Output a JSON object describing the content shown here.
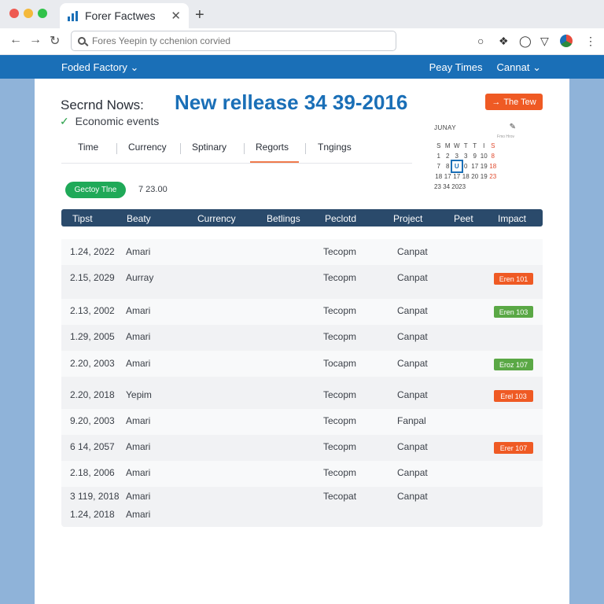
{
  "browser": {
    "tab_title": "Forer Factwes",
    "close_glyph": "✕",
    "new_tab_glyph": "+",
    "url_placeholder": "Fores Yeepin ty cchenion corvied"
  },
  "site": {
    "brand": "Foded Factory",
    "right_links": [
      "Peay Times",
      "Cannat"
    ]
  },
  "page": {
    "subtitle": "Secrnd Nows:",
    "events_label": "Economic events",
    "headline": "New rellease 34 39-2016",
    "cta_label": "The Tew",
    "filters": [
      "Time",
      "Currency",
      "Sptinary",
      "Regorts",
      "Tngings"
    ],
    "active_filter": 3,
    "pill_label": "Gectoy Tlne",
    "pill_value": "7 23.00"
  },
  "calendar": {
    "month": "JUNAY",
    "sub_label": "Fmo Hrov",
    "weekdays": [
      "S",
      "M",
      "W",
      "T",
      "T",
      "I",
      "S"
    ],
    "rows": [
      [
        "",
        "",
        "",
        "",
        "",
        "",
        ""
      ],
      [
        "1",
        "2",
        "3",
        "3",
        "9",
        "10",
        "8"
      ],
      [
        "7",
        "8",
        "U",
        "0",
        "17",
        "19",
        "18"
      ],
      [
        "18",
        "17",
        "17",
        "18",
        "20",
        "19",
        "23"
      ]
    ],
    "footer": "23 34 2023"
  },
  "table": {
    "headers": [
      "Tipst",
      "Beaty",
      "Currency",
      "Betlings",
      "Peclotd",
      "Project",
      "Peet",
      "Impact"
    ],
    "rows": [
      {
        "date": "1.24, 2022",
        "name": "Amari",
        "col3": "Tecopm",
        "col4": "Canpat",
        "badge": ""
      },
      {
        "date": "2.15, 2029",
        "name": "Aurray",
        "col3": "Tecopm",
        "col4": "Canpat",
        "badge": "Eren 101"
      },
      {
        "date": "2.13, 2002",
        "name": "Amari",
        "col3": "Tecopm",
        "col4": "Canpat",
        "badge": "Eren 103"
      },
      {
        "date": "1.29, 2005",
        "name": "Amari",
        "col3": "Tecopm",
        "col4": "Canpat",
        "badge": ""
      },
      {
        "date": "2.20, 2003",
        "name": "Amari",
        "col3": "Tocapm",
        "col4": "Canpat",
        "badge": "Eroz 107"
      },
      {
        "date": "2.20, 2018",
        "name": "Yepim",
        "col3": "Tecopm",
        "col4": "Canpat",
        "badge": "Erel 103"
      },
      {
        "date": "9.20, 2003",
        "name": "Amari",
        "col3": "Tecopm",
        "col4": "Fanpal",
        "badge": ""
      },
      {
        "date": "6 14, 2057",
        "name": "Amari",
        "col3": "Tecopm",
        "col4": "Canpat",
        "badge": "Erer 107"
      },
      {
        "date": "2.18, 2006",
        "name": "Amari",
        "col3": "Tecopm",
        "col4": "Canpat",
        "badge": ""
      },
      {
        "date": "3 119, 2018",
        "name": "Amari",
        "col3": "Tecopat",
        "col4": "Canpat",
        "badge": ""
      },
      {
        "date": "1.24, 2018",
        "name": "Amari",
        "col3": "",
        "col4": "",
        "badge": ""
      }
    ]
  },
  "colors": {
    "brand_blue": "#1a6fb7",
    "accent_orange": "#ef5a24",
    "accent_green": "#1fa958",
    "table_header": "#2a4a6b"
  }
}
